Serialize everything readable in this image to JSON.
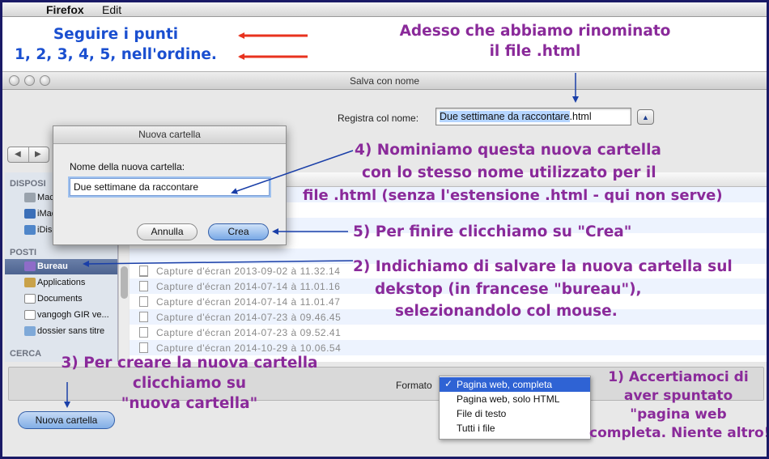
{
  "menubar": {
    "apple": "",
    "app": "Firefox",
    "edit": "Edit"
  },
  "window": {
    "title": "Salva con nome",
    "save_label": "Registra col nome:",
    "save_name_selected": "Due settimane da raccontare",
    "save_name_ext": ".html"
  },
  "sidebar": {
    "sections": [
      {
        "label": "DISPOSI",
        "items": [
          "Maci",
          "iMac",
          "iDisk"
        ]
      },
      {
        "label": "POSTI",
        "items": [
          "Bureau",
          "Applications",
          "Documents",
          "vangogh GIR ve...",
          "dossier sans titre"
        ]
      },
      {
        "label": "CERCA",
        "items": []
      }
    ],
    "selected": "Bureau"
  },
  "files": [
    "Capture d'écran 2013-09-02 à 11.32.14",
    "Capture d'écran 2014-07-14 à 11.01.16",
    "Capture d'écran 2014-07-14 à 11.01.47",
    "Capture d'écran 2014-07-23 à 09.46.45",
    "Capture d'écran 2014-07-23 à 09.52.41",
    "Capture d'écran 2014-10-29 à 10.06.54"
  ],
  "format": {
    "label": "Formato",
    "options": [
      "Pagina web, completa",
      "Pagina web, solo HTML",
      "File di testo",
      "Tutti i file"
    ],
    "check": "✓"
  },
  "new_folder_button": "Nuova cartella",
  "sheet": {
    "title": "Nuova cartella",
    "label": "Nome della nuova cartella:",
    "value": "Due settimane da raccontare",
    "cancel": "Annulla",
    "create": "Crea"
  },
  "annotations": {
    "intro": [
      "Seguire i punti",
      "1, 2, 3, 4, 5, nell'ordine."
    ],
    "top": [
      "Adesso che abbiamo rinominato",
      "il file .html"
    ],
    "step4": [
      "4) Nominiamo questa nuova cartella",
      "con lo stesso nome utilizzato per il",
      "file .html (senza l'estensione .html - qui non serve)"
    ],
    "step5": "5) Per finire clicchiamo su \"Crea\"",
    "step2": [
      "2) Indichiamo di salvare la nuova cartella sul",
      "dekstop (in francese \"bureau\"),",
      "selezionandolo col mouse."
    ],
    "step3": [
      "3) Per creare la nuova cartella",
      "clicchiamo su",
      "\"nuova cartella\""
    ],
    "step1": [
      "1) Accertiamoci di",
      "aver spuntato",
      "\"pagina web",
      "completa. Niente altro!"
    ]
  },
  "colors": {
    "arrow_red": "#e8321e",
    "arrow_blue": "#1a3fa8",
    "note_blue": "#1a4fd0",
    "note_purple": "#8a2a9a",
    "selection": "#2f63d4"
  }
}
